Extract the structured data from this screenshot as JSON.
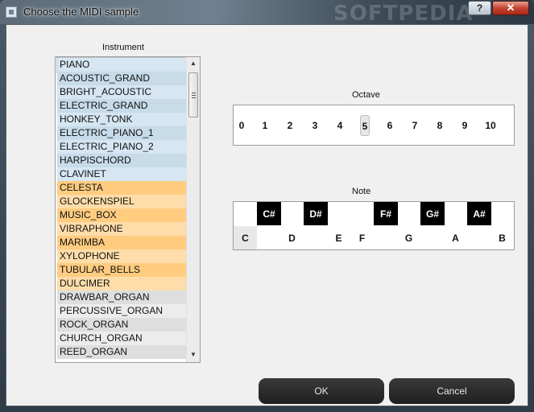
{
  "window": {
    "title": "Choose the MIDI sample",
    "watermark": "SOFTPEDIA",
    "help_label": "?",
    "close_label": "✕"
  },
  "instrument": {
    "label": "Instrument",
    "items": [
      {
        "label": "PIANO",
        "color": "#d6e6f2",
        "selected": true
      },
      {
        "label": "ACOUSTIC_GRAND",
        "color": "#c7dbe9"
      },
      {
        "label": "BRIGHT_ACOUSTIC",
        "color": "#d6e6f2"
      },
      {
        "label": "ELECTRIC_GRAND",
        "color": "#c7dbe9"
      },
      {
        "label": "HONKEY_TONK",
        "color": "#d6e6f2"
      },
      {
        "label": "ELECTRIC_PIANO_1",
        "color": "#c7dbe9"
      },
      {
        "label": "ELECTRIC_PIANO_2",
        "color": "#d6e6f2"
      },
      {
        "label": "HARPISCHORD",
        "color": "#c7dbe9"
      },
      {
        "label": "CLAVINET",
        "color": "#d6e6f2"
      },
      {
        "label": "CELESTA",
        "color": "#ffcc80"
      },
      {
        "label": "GLOCKENSPIEL",
        "color": "#ffddaa"
      },
      {
        "label": "MUSIC_BOX",
        "color": "#ffcc80"
      },
      {
        "label": "VIBRAPHONE",
        "color": "#ffddaa"
      },
      {
        "label": "MARIMBA",
        "color": "#ffcc80"
      },
      {
        "label": "XYLOPHONE",
        "color": "#ffddaa"
      },
      {
        "label": "TUBULAR_BELLS",
        "color": "#ffcc80"
      },
      {
        "label": "DULCIMER",
        "color": "#ffddaa"
      },
      {
        "label": "DRAWBAR_ORGAN",
        "color": "#dedede"
      },
      {
        "label": "PERCUSSIVE_ORGAN",
        "color": "#ececec"
      },
      {
        "label": "ROCK_ORGAN",
        "color": "#dedede"
      },
      {
        "label": "CHURCH_ORGAN",
        "color": "#ececec"
      },
      {
        "label": "REED_ORGAN",
        "color": "#dedede"
      }
    ]
  },
  "octave": {
    "label": "Octave",
    "values": [
      "0",
      "1",
      "2",
      "3",
      "4",
      "5",
      "6",
      "7",
      "8",
      "9",
      "10"
    ],
    "selected": "5"
  },
  "note": {
    "label": "Note",
    "white_keys": [
      "C",
      "D",
      "E",
      "F",
      "G",
      "A",
      "B"
    ],
    "black_keys": [
      "C#",
      "D#",
      "F#",
      "G#",
      "A#"
    ],
    "selected": "C"
  },
  "buttons": {
    "ok": "OK",
    "cancel": "Cancel"
  }
}
